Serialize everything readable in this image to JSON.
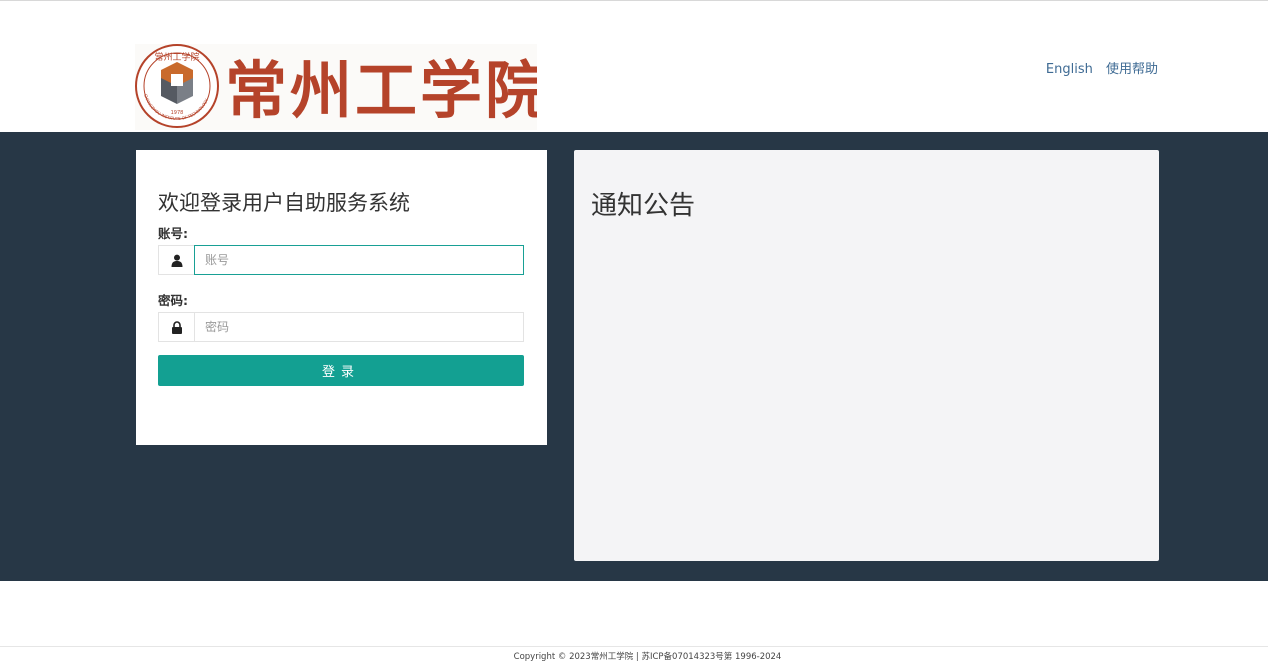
{
  "header": {
    "logo": {
      "seal_text_top": "常州工学院",
      "seal_text_ring": "CHANGZHOU INSTITUTE OF TECHNOLOGY",
      "seal_year": "1978",
      "wordmark": "常州工学院"
    },
    "links": {
      "english": "English",
      "help": "使用帮助"
    }
  },
  "login": {
    "title": "欢迎登录用户自助服务系统",
    "account_label": "账号:",
    "account_placeholder": "账号",
    "account_value": "",
    "password_label": "密码:",
    "password_placeholder": "密码",
    "password_value": "",
    "submit_label": "登录",
    "icons": [
      "user-icon",
      "lock-icon"
    ]
  },
  "notice": {
    "title": "通知公告"
  },
  "footer": {
    "text": "Copyright © 2023常州工学院 | 苏ICP备07014323号第 1996-2024"
  },
  "colors": {
    "band": "#273746",
    "accent": "#13a092",
    "link": "#3f6b94",
    "logo_red": "#b5432a"
  }
}
